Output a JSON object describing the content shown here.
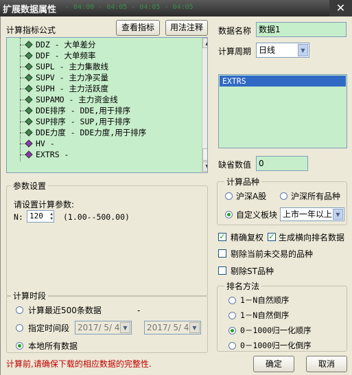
{
  "window": {
    "title": "扩展数据属性",
    "close_glyph": "✕",
    "ghost_text": "- 04:00 - 04:05 - 04:05 - 04:05"
  },
  "left": {
    "formula_label": "计算指标公式",
    "view_button": "查看指标",
    "help_button": "用法注释",
    "tree_items": [
      {
        "text": "DDZ - 大单差分",
        "icon": "green-diamond"
      },
      {
        "text": "DDF - 大单频率",
        "icon": "green-diamond"
      },
      {
        "text": "SUPL - 主力集散线",
        "icon": "green-diamond"
      },
      {
        "text": "SUPV - 主力净买量",
        "icon": "green-diamond"
      },
      {
        "text": "SUPH - 主力活跃度",
        "icon": "green-diamond"
      },
      {
        "text": "SUPAMO - 主力资金线",
        "icon": "green-diamond"
      },
      {
        "text": "DDE排序 - DDE,用于排序",
        "icon": "green-diamond"
      },
      {
        "text": "SUP排序 - SUP,用于排序",
        "icon": "green-diamond"
      },
      {
        "text": "DDE力度 - DDE力度,用于排序",
        "icon": "green-diamond"
      },
      {
        "text": "HV -",
        "icon": "purple-diamond"
      },
      {
        "text": "EXTRS -",
        "icon": "purple-diamond"
      }
    ],
    "params": {
      "group_label": "参数设置",
      "prompt": "请设置计算参数:",
      "n_label": "N:",
      "n_value": "120",
      "range": "(1.00--500.00)"
    },
    "period": {
      "group_label": "计算时段",
      "opt_recent": "计算最近500条数据",
      "opt_range": "指定时间段",
      "date_from": "2017/ 5/ 4",
      "date_to": "2017/ 5/ 4",
      "dash": "-",
      "opt_local": "本地所有数据",
      "selected": "opt_local"
    },
    "warning": "计算前,请确保下载的相应数据的完整性."
  },
  "right": {
    "data_name_label": "数据名称",
    "data_name_value": "数据1",
    "cycle_label": "计算周期",
    "cycle_value": "日线",
    "list_selected": "EXTRS",
    "default_label": "缺省数值",
    "default_value": "0",
    "variety": {
      "group_label": "计算品种",
      "opt_a": "沪深A股",
      "opt_all": "沪深所有品种",
      "opt_custom": "自定义板块",
      "custom_value": "上市一年以上",
      "selected": "opt_custom"
    },
    "checks": {
      "exact": {
        "label": "精确复权",
        "checked": true
      },
      "horizontal": {
        "label": "生成横向排名数据",
        "checked": true
      },
      "exclude_untraded": {
        "label": "剔除当前未交易的品种",
        "checked": false
      },
      "exclude_st": {
        "label": "剔除ST品种",
        "checked": false
      }
    },
    "ranking": {
      "group_label": "排名方法",
      "opt1": "1－N自然顺序",
      "opt2": "1－N自然倒序",
      "opt3": "0－1000归一化顺序",
      "opt4": "0－1000归一化倒序",
      "selected": "opt3"
    }
  },
  "footer": {
    "ok": "确定",
    "cancel": "取消"
  },
  "colors": {
    "panel_green": "#c7eecb",
    "selection_blue": "#316ac5",
    "warning_red": "#c00000",
    "face": "#ece9d8"
  }
}
